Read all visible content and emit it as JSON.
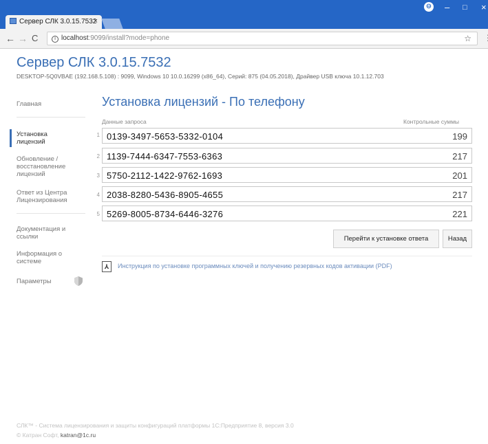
{
  "browser": {
    "tab_title": "Сервер СЛК 3.0.15.7532",
    "tab_close": "×",
    "url_host": "localhost",
    "url_path": ":9099/install?mode=phone",
    "minimize": "–",
    "maximize": "□",
    "close": "×"
  },
  "app": {
    "title": "Сервер СЛК 3.0.15.7532",
    "subtitle": "DESKTOP-5Q0VBAE (192.168.5.108) : 9099,  Windows 10 10.0.16299 (x86_64),  Серий: 875 (04.05.2018),  Драйвер USB ключа 10.1.12.703"
  },
  "sidebar": {
    "items": [
      {
        "label": "Главная"
      },
      {
        "label": "Установка\nлицензий"
      },
      {
        "label": "Обновление /\nвосстановление\nлицензий"
      },
      {
        "label": "Ответ из Центра\nЛицензирования"
      },
      {
        "label": "Документация и\nссылки"
      },
      {
        "label": "Информация о\nсистеме"
      },
      {
        "label": "Параметры"
      }
    ]
  },
  "main": {
    "heading": "Установка лицензий - По телефону",
    "col_request": "Данные запроса",
    "col_checksum": "Контрольные суммы",
    "rows": [
      {
        "num": "1",
        "code": "0139-3497-5653-5332-0104",
        "sum": "199"
      },
      {
        "num": "2",
        "code": "1139-7444-6347-7553-6363",
        "sum": "217"
      },
      {
        "num": "3",
        "code": "5750-2112-1422-9762-1693",
        "sum": "201"
      },
      {
        "num": "4",
        "code": "2038-8280-5436-8905-4655",
        "sum": "217"
      },
      {
        "num": "5",
        "code": "5269-8005-8734-6446-3276",
        "sum": "221"
      }
    ],
    "btn_next": "Перейти к установке ответа",
    "btn_back": "Назад",
    "pdf_link": "Инструкция по установке программных ключей и получению резервных кодов активации (PDF)"
  },
  "footer": {
    "line1": "СЛК™ - Система лицензирования и защиты конфигураций платформы 1С:Предприятие 8, версия 3.0",
    "line2_prefix": "© Катран Софт,",
    "email": "katran@1c.ru"
  },
  "colors": {
    "accent": "#3a6fb5",
    "titlebar": "#2566c6"
  }
}
